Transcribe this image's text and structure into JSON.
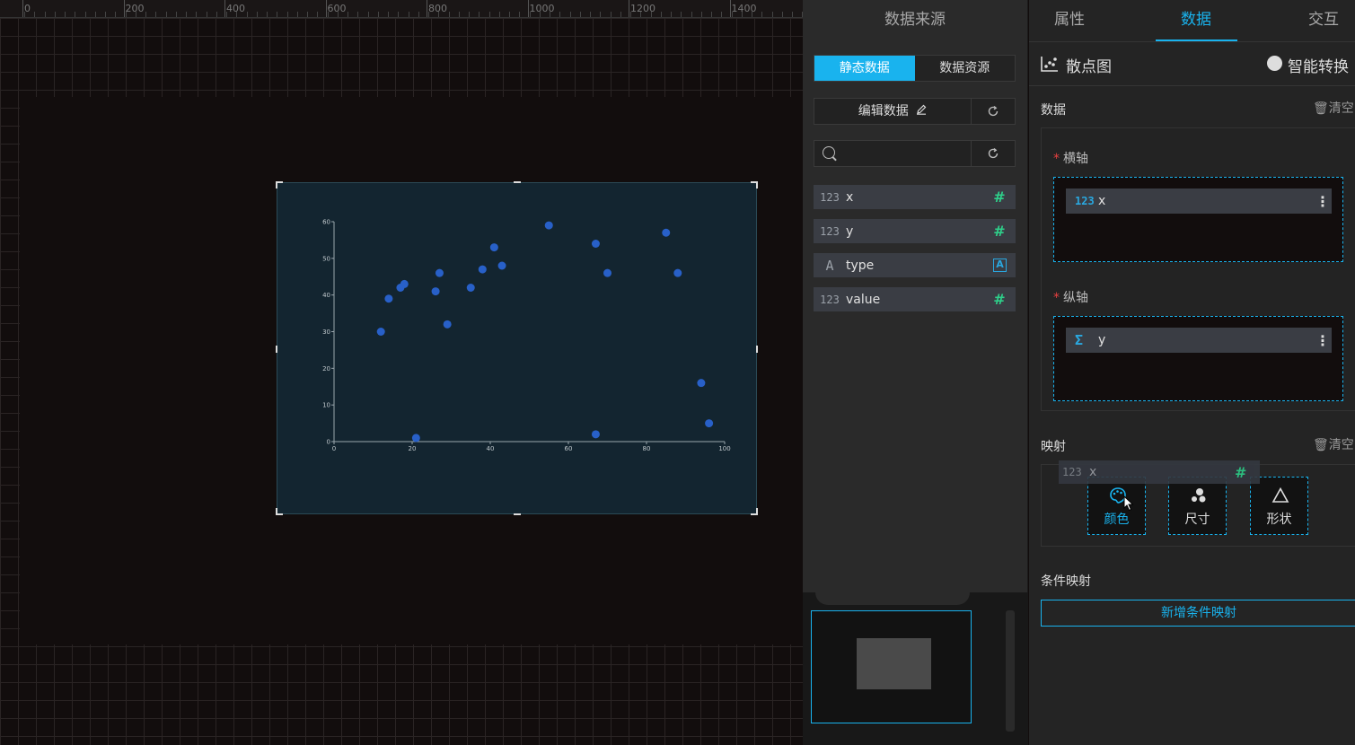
{
  "ruler": {
    "labels": [
      "0",
      "200",
      "400",
      "600",
      "800",
      "1000",
      "1200",
      "1400"
    ]
  },
  "source_panel": {
    "title": "数据来源",
    "tabs": [
      {
        "label": "静态数据",
        "active": true
      },
      {
        "label": "数据资源",
        "active": false
      }
    ],
    "edit_label": "编辑数据",
    "search_placeholder": "",
    "fields": [
      {
        "type": "123",
        "name": "x",
        "tag": "#"
      },
      {
        "type": "123",
        "name": "y",
        "tag": "#"
      },
      {
        "type": "A",
        "name": "type",
        "tag": "A"
      },
      {
        "type": "123",
        "name": "value",
        "tag": "#"
      }
    ]
  },
  "prop_panel": {
    "tabs": [
      {
        "label": "属性",
        "active": false
      },
      {
        "label": "数据",
        "active": true
      },
      {
        "label": "交互",
        "active": false
      }
    ],
    "chart_type": "散点图",
    "smart_convert": "智能转换",
    "data_section": {
      "title": "数据",
      "clear": "清空",
      "x_axis_label": "横轴",
      "x_field": {
        "type": "123",
        "name": "x"
      },
      "y_axis_label": "纵轴",
      "y_field": {
        "type": "Σ",
        "name": "y"
      }
    },
    "mapping_section": {
      "title": "映射",
      "clear": "清空",
      "buttons": [
        {
          "label": "颜色",
          "icon": "palette-icon",
          "active": true
        },
        {
          "label": "尺寸",
          "icon": "size-icon",
          "active": false
        },
        {
          "label": "形状",
          "icon": "triangle-icon",
          "active": false
        }
      ]
    },
    "condition_section": {
      "title": "条件映射",
      "add_label": "新增条件映射"
    },
    "drag_ghost": {
      "type": "123",
      "name": "x",
      "tag": "#"
    }
  },
  "colors": {
    "accent": "#19b3ee",
    "point": "#2860c8",
    "number_tag": "#2ecf8a"
  },
  "chart_data": {
    "type": "scatter",
    "title": "",
    "xlabel": "",
    "ylabel": "",
    "xlim": [
      0,
      100
    ],
    "ylim": [
      0,
      60
    ],
    "xticks": [
      "0",
      "20",
      "40",
      "60",
      "80",
      "100"
    ],
    "yticks": [
      "0",
      "10",
      "20",
      "30",
      "40",
      "50",
      "60"
    ],
    "points": [
      {
        "x": 12,
        "y": 30
      },
      {
        "x": 14,
        "y": 39
      },
      {
        "x": 17,
        "y": 42
      },
      {
        "x": 18,
        "y": 43
      },
      {
        "x": 21,
        "y": 1
      },
      {
        "x": 26,
        "y": 41
      },
      {
        "x": 27,
        "y": 46
      },
      {
        "x": 29,
        "y": 32
      },
      {
        "x": 35,
        "y": 42
      },
      {
        "x": 38,
        "y": 47
      },
      {
        "x": 41,
        "y": 53
      },
      {
        "x": 43,
        "y": 48
      },
      {
        "x": 55,
        "y": 59
      },
      {
        "x": 67,
        "y": 54
      },
      {
        "x": 67,
        "y": 2
      },
      {
        "x": 70,
        "y": 46
      },
      {
        "x": 85,
        "y": 57
      },
      {
        "x": 88,
        "y": 46
      },
      {
        "x": 94,
        "y": 16
      },
      {
        "x": 96,
        "y": 5
      }
    ]
  }
}
